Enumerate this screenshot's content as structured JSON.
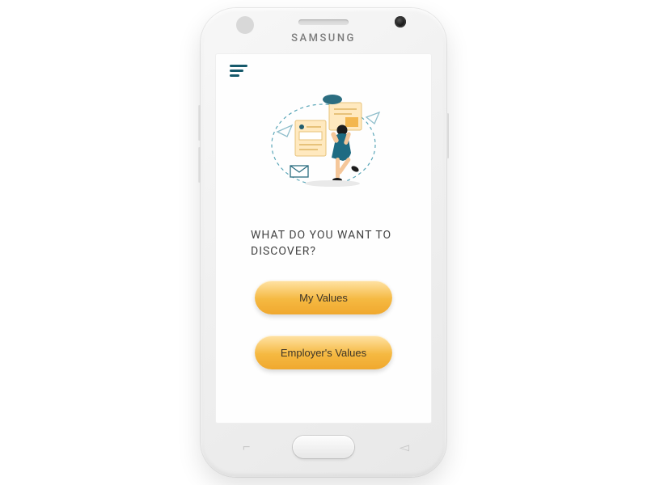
{
  "device": {
    "brand": "SAMSUNG"
  },
  "screen": {
    "question": "WHAT DO YOU WANT TO DISCOVER?",
    "buttons": {
      "my_values": "My Values",
      "employer_values": "Employer's Values"
    }
  },
  "colors": {
    "accent": "#16596b",
    "button_top": "#ffe3a6",
    "button_bottom": "#f0a82e"
  }
}
